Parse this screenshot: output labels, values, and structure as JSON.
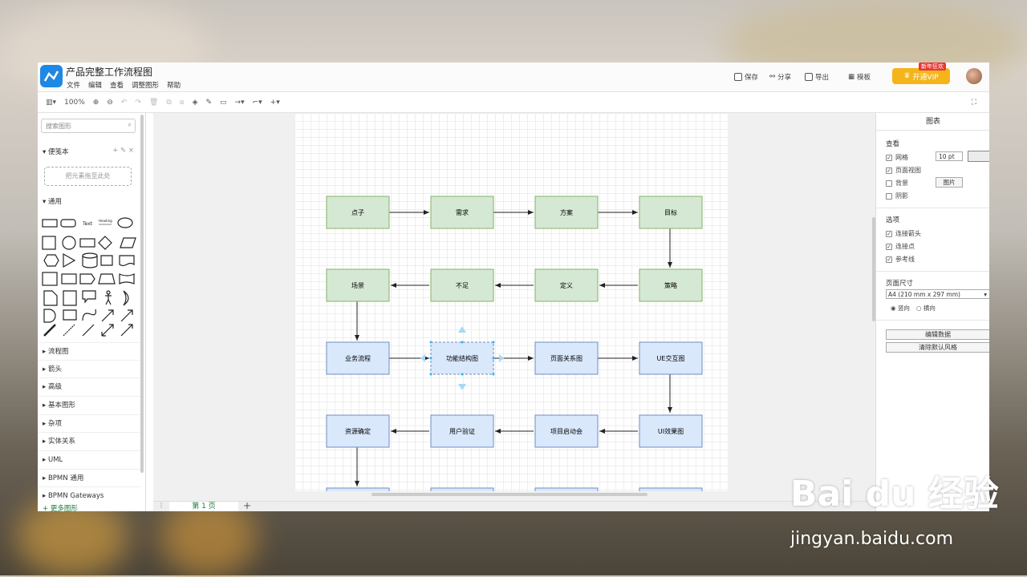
{
  "app": {
    "title": "产品完整工作流程图",
    "menus": [
      "文件",
      "编辑",
      "查看",
      "调整图形",
      "帮助"
    ],
    "save": "保存",
    "share": "分享",
    "export": "导出",
    "templates": "模板",
    "vip": "开通VIP",
    "vip_badge": "新年狂欢"
  },
  "toolbar": {
    "zoom": "100%"
  },
  "left": {
    "search_placeholder": "搜索图形",
    "scratchpad": "便笺本",
    "dropzone": "把元素拖至此处",
    "general": "通用",
    "categories": [
      "流程图",
      "箭头",
      "高级",
      "基本图形",
      "杂项",
      "实体关系",
      "UML",
      "BPMN 通用",
      "BPMN Gateways"
    ],
    "more_shapes": "+ 更多图形",
    "shape_text": "Text",
    "shape_heading": "Heading"
  },
  "flow": {
    "green_nodes": [
      "点子",
      "需求",
      "方案",
      "目标",
      "场景",
      "不足",
      "定义",
      "策略"
    ],
    "blue_nodes": [
      "业务流程",
      "功能结构图",
      "页面关系图",
      "UE交互图",
      "资源确定",
      "用户验证",
      "项目启动会",
      "UI效果图"
    ],
    "colors": {
      "green_fill": "#d5e8d4",
      "green_stroke": "#82b366",
      "blue_fill": "#dae8fc",
      "blue_stroke": "#6c8ebf"
    }
  },
  "bottom": {
    "page_tab": "第 1 页"
  },
  "right": {
    "title": "图表",
    "view_label": "查看",
    "grid": "网格",
    "grid_size": "10 pt",
    "page_view": "页面视图",
    "background": "背景",
    "image_btn": "图片",
    "shadow": "阴影",
    "options_label": "选项",
    "connection_arrows": "连接箭头",
    "connection_points": "连接点",
    "guides": "参考线",
    "paper_size_label": "页面尺寸",
    "paper_size": "A4 (210 mm x 297 mm)",
    "portrait": "竖向",
    "landscape": "横向",
    "edit_data": "编辑数据",
    "clear_style": "清除默认风格"
  },
  "watermark": {
    "brand": "Bai du 经验",
    "url": "jingyan.baidu.com"
  }
}
